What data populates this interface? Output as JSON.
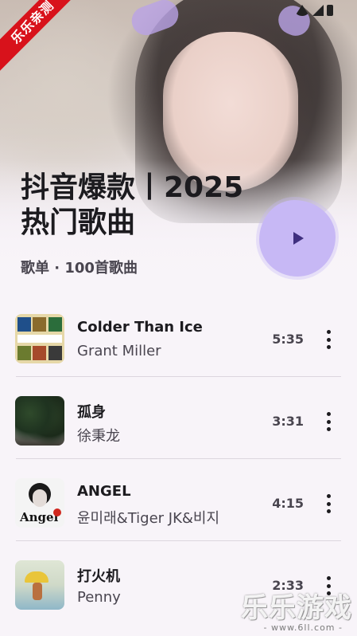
{
  "badge": {
    "text": "乐乐亲测"
  },
  "playlist": {
    "title": "抖音爆款丨2025热门歌曲",
    "subtitle": "歌单 · 100首歌曲"
  },
  "songs": [
    {
      "title": "Colder Than Ice",
      "artist": "Grant Miller",
      "duration": "5:35",
      "cover_icon": "album-cover-collage"
    },
    {
      "title": "孤身",
      "artist": "徐秉龙",
      "duration": "3:31",
      "cover_icon": "album-cover-trees"
    },
    {
      "title": "ANGEL",
      "artist": "윤미래&Tiger JK&비지",
      "duration": "4:15",
      "cover_icon": "album-cover-angel"
    },
    {
      "title": "打火机",
      "artist": "Penny",
      "duration": "2:33",
      "cover_icon": "album-cover-umbrella"
    }
  ],
  "watermark": {
    "main": "乐乐游戏",
    "sub": "- www.6ll.com -"
  },
  "colors": {
    "accent": "#c7b8f5",
    "play_icon": "#3f2f7f",
    "background": "#f8f4f9",
    "badge": "#d8121b"
  }
}
